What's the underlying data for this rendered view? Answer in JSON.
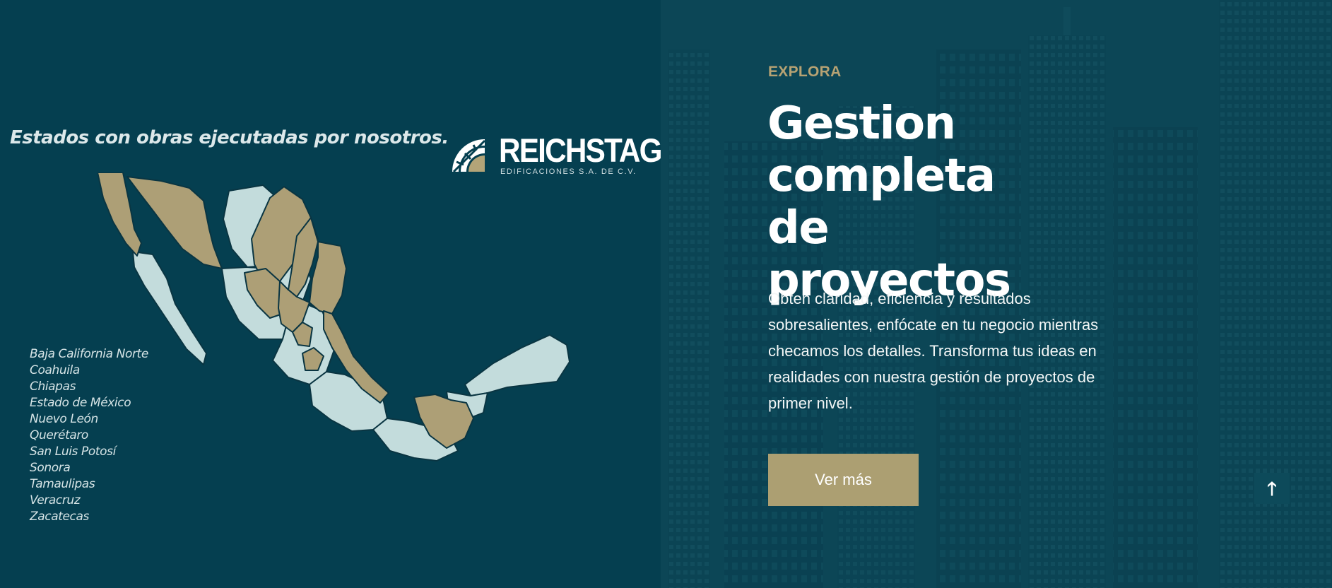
{
  "colors": {
    "background": "#0c4656",
    "panel": "#053f50",
    "accent_gold": "#ac9f72",
    "map_land": "#c3dcdc",
    "map_highlight": "#ad9f76"
  },
  "map_panel": {
    "caption": "Estados con obras ejecutadas por nosotros.",
    "logo": {
      "name": "REICHSTAG",
      "subtitle": "EDIFICACIONES S.A. DE C.V."
    },
    "states": [
      "Baja California Norte",
      "Coahuila",
      "Chiapas",
      "Estado de México",
      "Nuevo León",
      "Querétaro",
      "San Luis Potosí",
      "Sonora",
      "Tamaulipas",
      "Veracruz",
      "Zacatecas"
    ]
  },
  "hero": {
    "eyebrow": "EXPLORA",
    "title": "Gestion completa de proyectos",
    "body": "Obten claridad, eficiencia y resultados sobresalientes, enfócate en tu negocio mientras checamos los detalles. Transforma tus ideas en realidades con nuestra gestión de proyectos de primer nivel.",
    "cta_label": "Ver más"
  },
  "scroll_top": {
    "icon": "arrow-up-icon",
    "glyph": "🡑"
  }
}
